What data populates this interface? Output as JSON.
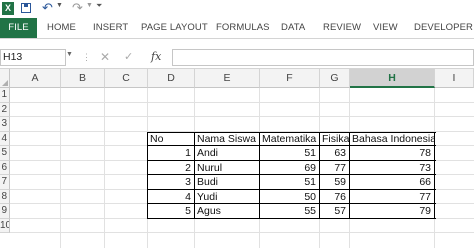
{
  "quick_access": {
    "logo_text": "X"
  },
  "ribbon": {
    "tabs": [
      "FILE",
      "HOME",
      "INSERT",
      "PAGE LAYOUT",
      "FORMULAS",
      "DATA",
      "REVIEW",
      "VIEW",
      "DEVELOPER"
    ]
  },
  "formula_bar": {
    "name_box": "H13",
    "fx_label": "fx",
    "formula": ""
  },
  "sheet": {
    "columns": [
      "A",
      "B",
      "C",
      "D",
      "E",
      "F",
      "G",
      "H",
      "I"
    ],
    "selected_column": "H",
    "rows": [
      "1",
      "2",
      "3",
      "4",
      "5",
      "6",
      "7",
      "8",
      "9",
      "10"
    ],
    "table": {
      "headers": [
        "No",
        "Nama Siswa",
        "Matematika",
        "Fisika",
        "Bahasa Indonesia"
      ],
      "records": [
        [
          "1",
          "Andi",
          "51",
          "63",
          "78"
        ],
        [
          "2",
          "Nurul",
          "69",
          "77",
          "73"
        ],
        [
          "3",
          "Budi",
          "51",
          "59",
          "66"
        ],
        [
          "4",
          "Yudi",
          "50",
          "76",
          "77"
        ],
        [
          "5",
          "Agus",
          "55",
          "57",
          "79"
        ]
      ]
    }
  },
  "colors": {
    "accent": "#217346",
    "ribbon_text": "#444444"
  }
}
